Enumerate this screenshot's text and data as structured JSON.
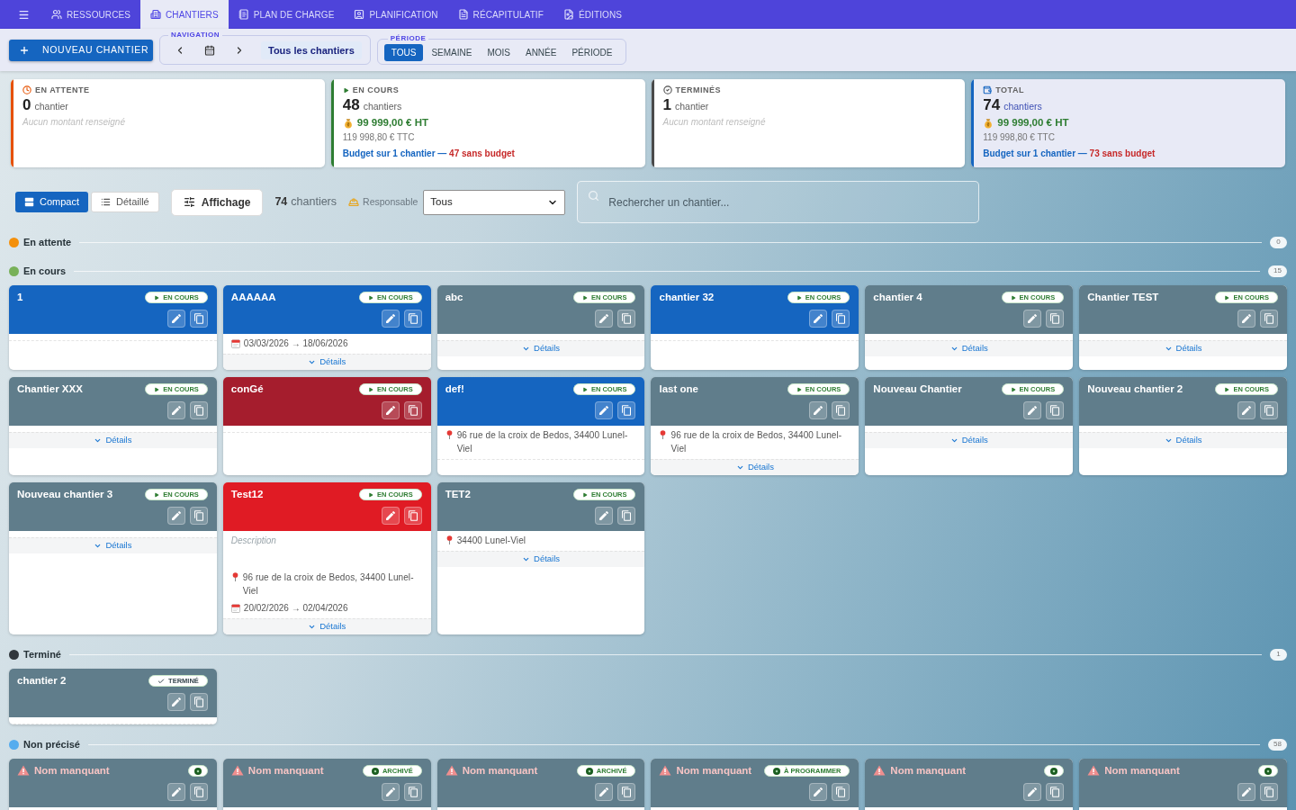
{
  "nav": {
    "tabs": [
      {
        "label": "RESSOURCES",
        "selected": false
      },
      {
        "label": "CHANTIERS",
        "selected": true
      },
      {
        "label": "PLAN DE CHARGE",
        "selected": false
      },
      {
        "label": "PLANIFICATION",
        "selected": false
      },
      {
        "label": "RÉCAPITULATIF",
        "selected": false
      },
      {
        "label": "ÉDITIONS",
        "selected": false
      }
    ]
  },
  "toolbar": {
    "new_button": "NOUVEAU CHANTIER",
    "navigation": {
      "legend": "NAVIGATION",
      "scope": "Tous les chantiers"
    },
    "period": {
      "legend": "PÉRIODE",
      "options": [
        {
          "label": "TOUS",
          "selected": true
        },
        {
          "label": "SEMAINE",
          "selected": false
        },
        {
          "label": "MOIS",
          "selected": false
        },
        {
          "label": "ANNÉE",
          "selected": false
        },
        {
          "label": "PÉRIODE",
          "selected": false
        }
      ]
    }
  },
  "stats": [
    {
      "kind": "pending",
      "title": "EN ATTENTE",
      "color": "#e65100",
      "count": "0",
      "unit": "chantier",
      "note": "Aucun montant renseigné"
    },
    {
      "kind": "in_progress",
      "title": "EN COURS",
      "color": "#2e7d32",
      "count": "48",
      "unit": "chantiers",
      "amount_ht": "99 999,00 € HT",
      "amount_ttc": "119 998,80 € TTC",
      "budget": "Budget sur 1 chantier —",
      "without_budget": "47 sans budget"
    },
    {
      "kind": "done",
      "title": "TERMINÉS",
      "color": "#4a4a4a",
      "count": "1",
      "unit": "chantier",
      "note": "Aucun montant renseigné"
    },
    {
      "kind": "total",
      "title": "TOTAL",
      "color": "#1565c0",
      "count": "74",
      "unit": "chantiers",
      "amount_ht": "99 999,00 € HT",
      "amount_ttc": "119 998,80 € TTC",
      "budget": "Budget sur 1 chantier —",
      "without_budget": "73 sans budget"
    }
  ],
  "filters": {
    "views": [
      {
        "kind": "compact",
        "label": "Compact",
        "selected": true
      },
      {
        "kind": "detailed",
        "label": "Détaillé",
        "selected": false
      }
    ],
    "display_button": "Affichage",
    "count": "74",
    "count_unit": "chantiers",
    "manager_label": "Responsable",
    "manager_select": "Tous",
    "search": {
      "placeholder": "Rechercher un chantier..."
    }
  },
  "sections": [
    {
      "label": "En attente",
      "color": "#f4900c",
      "count": "0"
    },
    {
      "label": "En cours",
      "color": "#78b159",
      "count": "15",
      "cards": [
        {
          "kind": "named",
          "title": "1",
          "color": "#1565c0",
          "status": {
            "kind": "in_progress",
            "label": "EN COURS"
          }
        },
        {
          "kind": "named",
          "title": "AAAAAA",
          "color": "#1565c0",
          "status": {
            "kind": "in_progress",
            "label": "EN COURS"
          },
          "lines": [
            {
              "kind": "dates",
              "text": "03/03/2026 → 18/06/2026"
            }
          ],
          "details": "Détails"
        },
        {
          "kind": "named",
          "title": "abc",
          "color": "#607d8b",
          "status": {
            "kind": "in_progress",
            "label": "EN COURS"
          },
          "details": "Détails"
        },
        {
          "kind": "named",
          "title": "chantier 32",
          "color": "#1565c0",
          "status": {
            "kind": "in_progress",
            "label": "EN COURS"
          }
        },
        {
          "kind": "named",
          "title": "chantier 4",
          "color": "#607d8b",
          "status": {
            "kind": "in_progress",
            "label": "EN COURS"
          },
          "details": "Détails"
        },
        {
          "kind": "named",
          "title": "Chantier TEST",
          "color": "#607d8b",
          "status": {
            "kind": "in_progress",
            "label": "EN COURS"
          },
          "details": "Détails"
        },
        {
          "kind": "named",
          "title": "Chantier XXX",
          "color": "#607d8b",
          "status": {
            "kind": "in_progress",
            "label": "EN COURS"
          },
          "details": "Détails"
        },
        {
          "kind": "named",
          "title": "conGé",
          "color": "#a51d2d",
          "status": {
            "kind": "in_progress",
            "label": "EN COURS"
          }
        },
        {
          "kind": "named",
          "title": "def!",
          "color": "#1565c0",
          "status": {
            "kind": "in_progress",
            "label": "EN COURS"
          },
          "lines": [
            {
              "kind": "address",
              "text": "96 rue de la croix de Bedos, 34400 Lunel-Viel"
            }
          ]
        },
        {
          "kind": "named",
          "title": "last one",
          "color": "#607d8b",
          "status": {
            "kind": "in_progress",
            "label": "EN COURS"
          },
          "lines": [
            {
              "kind": "address",
              "text": "96 rue de la croix de Bedos, 34400 Lunel-Viel"
            }
          ],
          "details": "Détails"
        },
        {
          "kind": "named",
          "title": "Nouveau Chantier",
          "color": "#607d8b",
          "status": {
            "kind": "in_progress",
            "label": "EN COURS"
          },
          "details": "Détails"
        },
        {
          "kind": "named",
          "title": "Nouveau chantier 2",
          "color": "#607d8b",
          "status": {
            "kind": "in_progress",
            "label": "EN COURS"
          },
          "details": "Détails"
        },
        {
          "kind": "named",
          "title": "Nouveau chantier 3",
          "color": "#607d8b",
          "status": {
            "kind": "in_progress",
            "label": "EN COURS"
          },
          "details": "Détails"
        },
        {
          "kind": "named",
          "title": "Test12",
          "color": "#e01b24",
          "status": {
            "kind": "in_progress",
            "label": "EN COURS"
          },
          "lines": [
            {
              "kind": "description",
              "text": "Description"
            },
            {
              "kind": "address",
              "text": "96 rue de la croix de Bedos, 34400 Lunel-Viel"
            },
            {
              "kind": "dates",
              "text": "20/02/2026 → 02/04/2026"
            }
          ],
          "details": "Détails"
        },
        {
          "kind": "named",
          "title": "TET2",
          "color": "#607d8b",
          "status": {
            "kind": "in_progress",
            "label": "EN COURS"
          },
          "lines": [
            {
              "kind": "address",
              "text": "34400 Lunel-Viel"
            }
          ],
          "details": "Détails"
        }
      ]
    },
    {
      "label": "Terminé",
      "color": "#31373d",
      "count": "1",
      "cards": [
        {
          "kind": "named",
          "title": "chantier 2",
          "color": "#607d8b",
          "status": {
            "kind": "done",
            "label": "TERMINÉ"
          }
        }
      ]
    },
    {
      "label": "Non précisé",
      "color": "#55acee",
      "count": "58",
      "cards": [
        {
          "kind": "missing_name",
          "title": "Nom manquant",
          "color": "#607d8b",
          "status": {
            "kind": "other"
          }
        },
        {
          "kind": "missing_name",
          "title": "Nom manquant",
          "color": "#607d8b",
          "status": {
            "kind": "other",
            "label": "ARCHIVÉ"
          }
        },
        {
          "kind": "missing_name",
          "title": "Nom manquant",
          "color": "#607d8b",
          "status": {
            "kind": "other",
            "label": "ARCHIVÉ"
          }
        },
        {
          "kind": "missing_name",
          "title": "Nom manquant",
          "color": "#607d8b",
          "status": {
            "kind": "other",
            "label": "À PROGRAMMER"
          }
        },
        {
          "kind": "missing_name",
          "title": "Nom manquant",
          "color": "#607d8b",
          "status": {
            "kind": "other"
          }
        },
        {
          "kind": "missing_name",
          "title": "Nom manquant",
          "color": "#607d8b",
          "status": {
            "kind": "other"
          }
        }
      ]
    }
  ]
}
